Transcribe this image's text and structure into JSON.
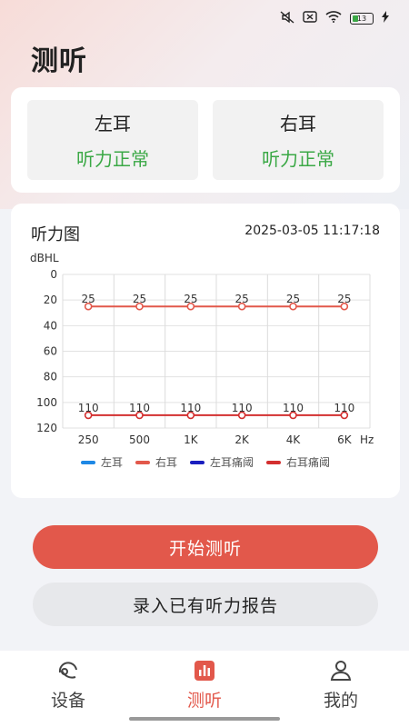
{
  "status": {
    "battery_level": "13",
    "icons": [
      "silent-icon",
      "sim-off-icon",
      "wifi-icon",
      "battery-icon",
      "charging-icon"
    ]
  },
  "page": {
    "title": "测听"
  },
  "ears": {
    "left": {
      "name": "左耳",
      "status": "听力正常"
    },
    "right": {
      "name": "右耳",
      "status": "听力正常"
    }
  },
  "chart_card": {
    "title": "听力图",
    "datetime": "2025-03-05 11:17:18"
  },
  "chart_data": {
    "type": "line",
    "title": "",
    "ylabel": "dBHL",
    "xlabel": "Hz",
    "categories": [
      "250",
      "500",
      "1K",
      "2K",
      "4K",
      "6K"
    ],
    "ylim": [
      0,
      120
    ],
    "y_ticks": [
      0,
      20,
      40,
      60,
      80,
      100,
      120
    ],
    "y_inverted": true,
    "grid": true,
    "legend_position": "bottom",
    "series": [
      {
        "name": "左耳",
        "color": "#1e88e5",
        "values": []
      },
      {
        "name": "右耳",
        "color": "#e2584b",
        "values": [
          25,
          25,
          25,
          25,
          25,
          25
        ]
      },
      {
        "name": "左耳痛阈",
        "color": "#1a1fbf",
        "values": []
      },
      {
        "name": "右耳痛阈",
        "color": "#d32f2f",
        "values": [
          110,
          110,
          110,
          110,
          110,
          110
        ]
      }
    ]
  },
  "actions": {
    "start_label": "开始测听",
    "import_label": "录入已有听力报告"
  },
  "tabbar": {
    "items": [
      {
        "label": "设备",
        "icon": "headphones-icon",
        "active": false
      },
      {
        "label": "测听",
        "icon": "hearing-test-icon",
        "active": true
      },
      {
        "label": "我的",
        "icon": "user-icon",
        "active": false
      }
    ]
  },
  "colors": {
    "accent": "#e2584b",
    "normal": "#3aa845"
  }
}
